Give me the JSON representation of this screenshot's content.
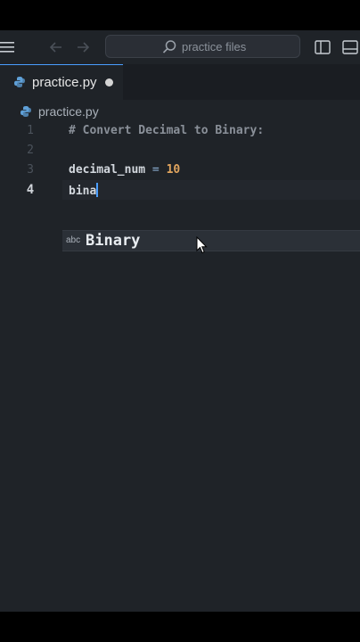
{
  "titlebar": {
    "search_text": "practice files"
  },
  "tab": {
    "label": "practice.py",
    "dirty": true
  },
  "breadcrumb": {
    "file": "practice.py"
  },
  "editor": {
    "lines": [
      {
        "number": "1",
        "comment": "# Convert Decimal to Binary:"
      },
      {
        "number": "2"
      },
      {
        "number": "3",
        "ident": "decimal_num",
        "op": "=",
        "num": "10"
      },
      {
        "number": "4",
        "typed": "bina"
      }
    ]
  },
  "completion": {
    "kind": "abc",
    "label": "Binary"
  },
  "colors": {
    "accent": "#4a9eff",
    "background": "#1f2328",
    "number": "#e0a45e"
  },
  "icons": {
    "menu": "hamburger-menu-icon",
    "back": "arrow-left-icon",
    "forward": "arrow-right-icon",
    "search": "search-icon",
    "sidebar": "toggle-sidebar-icon",
    "panel": "toggle-panel-icon",
    "file": "python-file-icon"
  }
}
